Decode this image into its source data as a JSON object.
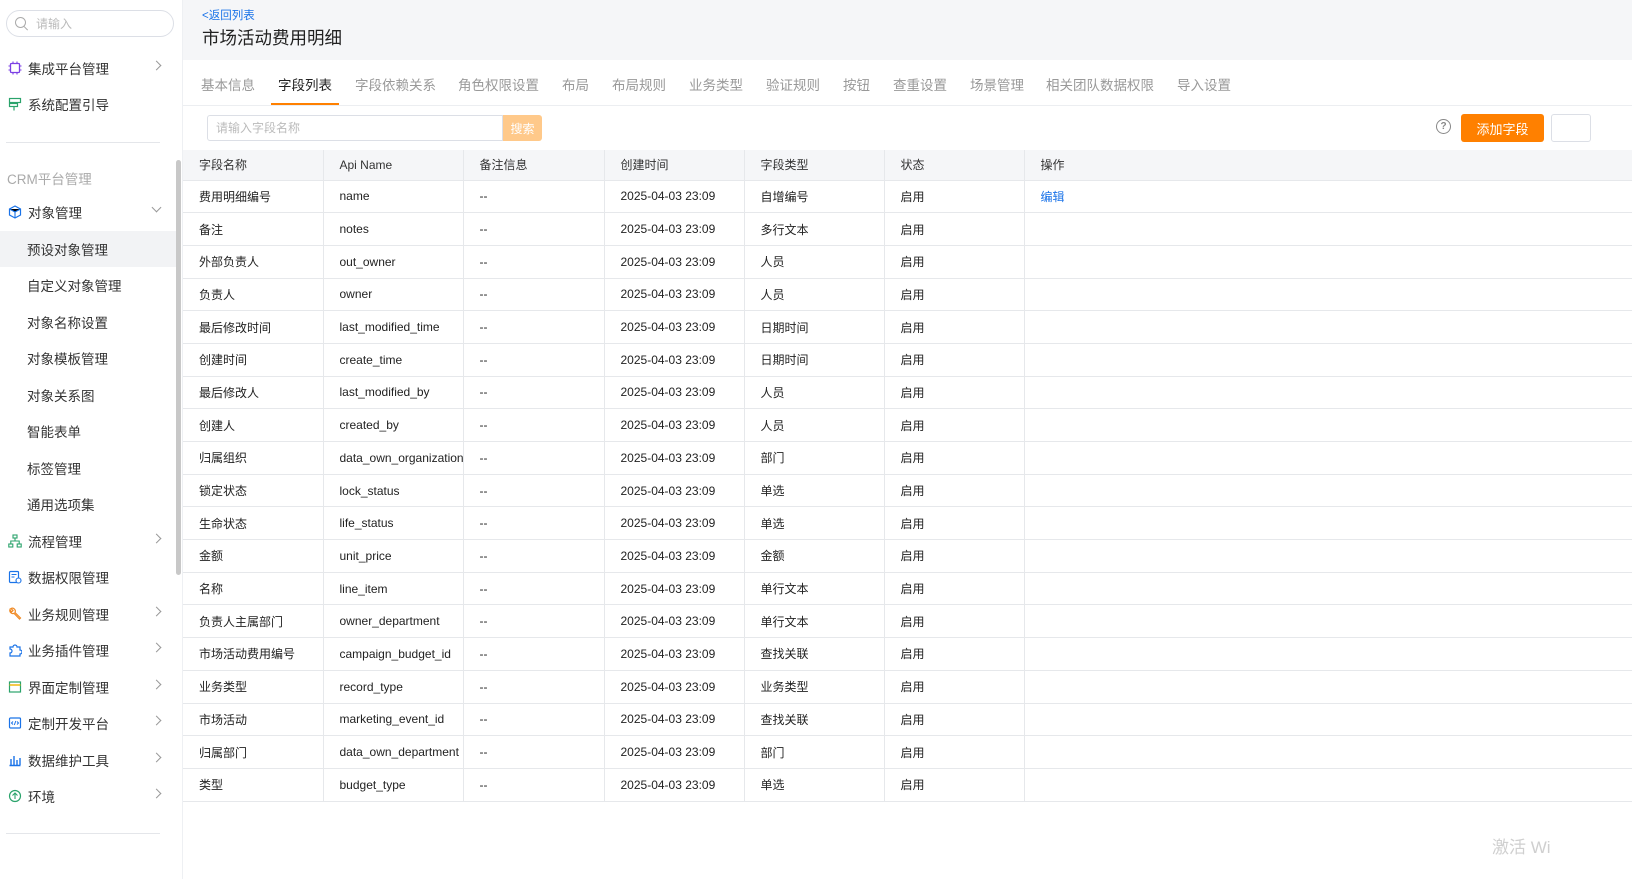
{
  "sidebar": {
    "search_placeholder": "请输入",
    "top_items": [
      {
        "label": "集成平台管理",
        "icon": "chip-icon"
      },
      {
        "label": "系统配置引导",
        "icon": "signpost-icon"
      }
    ],
    "section_label": "CRM平台管理",
    "object_mgmt": "对象管理",
    "sub_items": [
      "预设对象管理",
      "自定义对象管理",
      "对象名称设置",
      "对象模板管理",
      "对象关系图",
      "智能表单",
      "标签管理",
      "通用选项集"
    ],
    "bottom_items": [
      {
        "label": "流程管理",
        "icon": "flow-icon"
      },
      {
        "label": "数据权限管理",
        "icon": "data-lock-icon"
      },
      {
        "label": "业务规则管理",
        "icon": "wrench-icon"
      },
      {
        "label": "业务插件管理",
        "icon": "puzzle-icon"
      },
      {
        "label": "界面定制管理",
        "icon": "layout-icon"
      },
      {
        "label": "定制开发平台",
        "icon": "code-icon"
      },
      {
        "label": "数据维护工具",
        "icon": "bar-chart-icon"
      },
      {
        "label": "环境",
        "icon": "environment-icon"
      }
    ]
  },
  "header": {
    "back_label": "<返回列表",
    "title": "市场活动费用明细"
  },
  "tabs": [
    "基本信息",
    "字段列表",
    "字段依赖关系",
    "角色权限设置",
    "布局",
    "布局规则",
    "业务类型",
    "验证规则",
    "按钮",
    "查重设置",
    "场景管理",
    "相关团队数据权限",
    "导入设置"
  ],
  "active_tab": "字段列表",
  "toolbar": {
    "search_placeholder": "请输入字段名称",
    "search_button": "搜索",
    "add_button": "添加字段",
    "help_symbol": "?"
  },
  "table": {
    "columns": [
      "字段名称",
      "Api Name",
      "备注信息",
      "创建时间",
      "字段类型",
      "状态",
      "操作"
    ],
    "rows": [
      [
        "费用明细编号",
        "name",
        "--",
        "2025-04-03 23:09",
        "自增编号",
        "启用",
        "编辑"
      ],
      [
        "备注",
        "notes",
        "--",
        "2025-04-03 23:09",
        "多行文本",
        "启用",
        ""
      ],
      [
        "外部负责人",
        "out_owner",
        "--",
        "2025-04-03 23:09",
        "人员",
        "启用",
        ""
      ],
      [
        "负责人",
        "owner",
        "--",
        "2025-04-03 23:09",
        "人员",
        "启用",
        ""
      ],
      [
        "最后修改时间",
        "last_modified_time",
        "--",
        "2025-04-03 23:09",
        "日期时间",
        "启用",
        ""
      ],
      [
        "创建时间",
        "create_time",
        "--",
        "2025-04-03 23:09",
        "日期时间",
        "启用",
        ""
      ],
      [
        "最后修改人",
        "last_modified_by",
        "--",
        "2025-04-03 23:09",
        "人员",
        "启用",
        ""
      ],
      [
        "创建人",
        "created_by",
        "--",
        "2025-04-03 23:09",
        "人员",
        "启用",
        ""
      ],
      [
        "归属组织",
        "data_own_organization",
        "--",
        "2025-04-03 23:09",
        "部门",
        "启用",
        ""
      ],
      [
        "锁定状态",
        "lock_status",
        "--",
        "2025-04-03 23:09",
        "单选",
        "启用",
        ""
      ],
      [
        "生命状态",
        "life_status",
        "--",
        "2025-04-03 23:09",
        "单选",
        "启用",
        ""
      ],
      [
        "金额",
        "unit_price",
        "--",
        "2025-04-03 23:09",
        "金额",
        "启用",
        ""
      ],
      [
        "名称",
        "line_item",
        "--",
        "2025-04-03 23:09",
        "单行文本",
        "启用",
        ""
      ],
      [
        "负责人主属部门",
        "owner_department",
        "--",
        "2025-04-03 23:09",
        "单行文本",
        "启用",
        ""
      ],
      [
        "市场活动费用编号",
        "campaign_budget_id",
        "--",
        "2025-04-03 23:09",
        "查找关联",
        "启用",
        ""
      ],
      [
        "业务类型",
        "record_type",
        "--",
        "2025-04-03 23:09",
        "业务类型",
        "启用",
        ""
      ],
      [
        "市场活动",
        "marketing_event_id",
        "--",
        "2025-04-03 23:09",
        "查找关联",
        "启用",
        ""
      ],
      [
        "归属部门",
        "data_own_department",
        "--",
        "2025-04-03 23:09",
        "部门",
        "启用",
        ""
      ],
      [
        "类型",
        "budget_type",
        "--",
        "2025-04-03 23:09",
        "单选",
        "启用",
        ""
      ]
    ]
  },
  "watermark": "激活 Wi",
  "colors": {
    "accent": "#ff8000",
    "link": "#1a73e8",
    "search_button": "#ffc98a"
  }
}
